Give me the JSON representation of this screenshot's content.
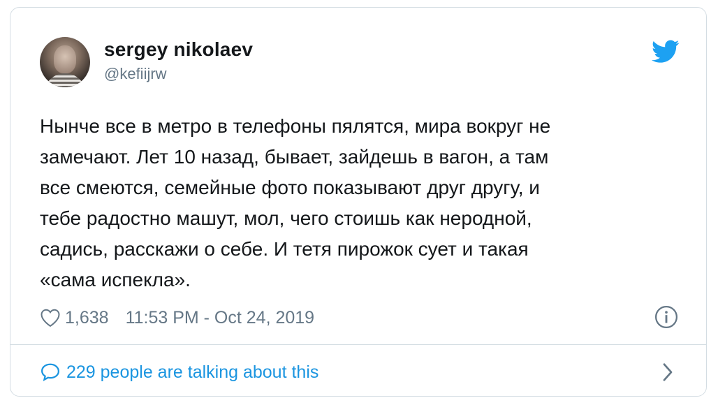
{
  "author": {
    "name": "sergey nikolaev",
    "handle": "@kefiijrw"
  },
  "tweet": {
    "text": "Нынче все в метро в телефоны пялятся, мира вокруг не\nзамечают. Лет 10 назад, бывает, зайдешь в вагон, а там\nвсе смеются, семейные фото показывают друг другу, и\nтебе радостно машут, мол, чего стоишь как неродной,\nсадись, расскажи о себе. И тетя пирожок сует и такая\n«сама испекла»."
  },
  "meta": {
    "likes": "1,638",
    "timestamp": "11:53 PM - Oct 24, 2019"
  },
  "footer": {
    "talking": "229 people are talking about this"
  },
  "icons": {
    "brand": "twitter-bird-icon",
    "like": "heart-icon",
    "info": "info-icon",
    "replies": "speech-bubble-icon",
    "more": "chevron-right-icon"
  },
  "colors": {
    "brand_blue": "#1da1f2",
    "link_blue": "#1b95e0",
    "muted_gray": "#657786",
    "text": "#14171a",
    "border": "#d4dde3"
  }
}
